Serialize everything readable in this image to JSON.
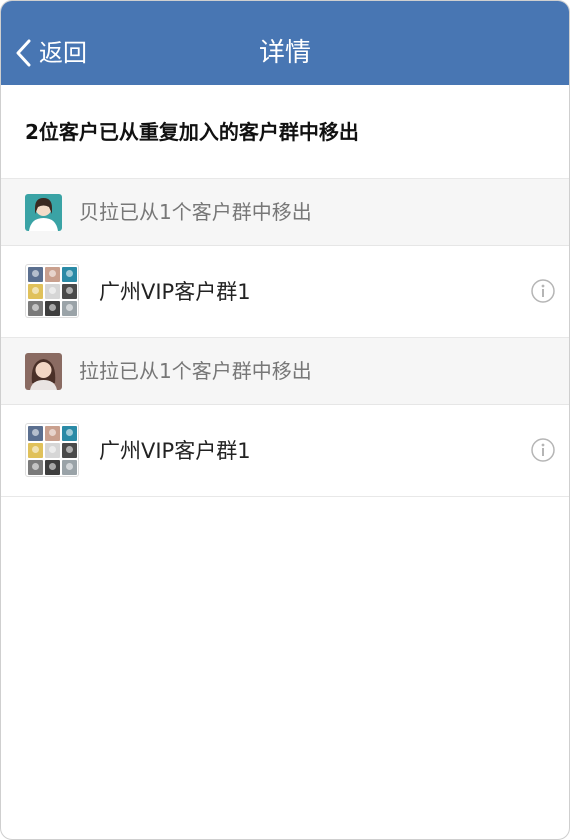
{
  "nav": {
    "back_label": "返回",
    "title": "详情",
    "bar_color": "#4876b3"
  },
  "summary": {
    "text": "2位客户已从重复加入的客户群中移出"
  },
  "sections": [
    {
      "header_label": "贝拉已从1个客户群中移出",
      "avatar_color": "#3aa3a5",
      "groups": [
        {
          "name": "广州VIP客户群1",
          "info_icon": "info-circle-icon"
        }
      ]
    },
    {
      "header_label": "拉拉已从1个客户群中移出",
      "avatar_color": "#8a6b62",
      "groups": [
        {
          "name": "广州VIP客户群1",
          "info_icon": "info-circle-icon"
        }
      ]
    }
  ],
  "group_avatar_tile_colors": [
    "#5b6f8f",
    "#c9a08e",
    "#2a8aa6",
    "#e0c15a",
    "#d6d6d6",
    "#4a4a4a",
    "#7a7a7a",
    "#3e3e3e",
    "#9aa3a8"
  ]
}
